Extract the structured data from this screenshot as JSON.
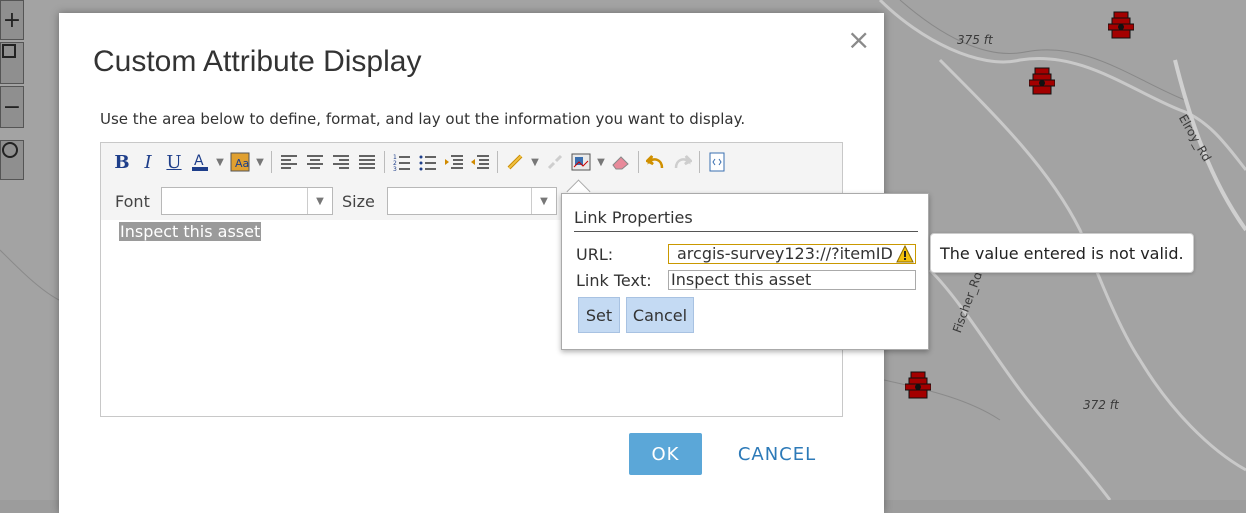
{
  "map": {
    "elevation_labels": [
      "375 ft",
      "372 ft"
    ],
    "road_labels": [
      "Elroy_Rd",
      "Fischer_Rd"
    ],
    "zoom_in": "+",
    "zoom_out": "−"
  },
  "dialog": {
    "title": "Custom Attribute Display",
    "close": "×",
    "instructions": "Use the area below to define, format, and lay out the information you want to display.",
    "toolbar": {
      "font_label": "Font",
      "font_value": "",
      "size_label": "Size",
      "size_value": ""
    },
    "editor_text": "Inspect this asset",
    "ok": "OK",
    "cancel": "CANCEL"
  },
  "link_popup": {
    "title": "Link Properties",
    "url_label": "URL:",
    "url_value": "arcgis-survey123://?itemID",
    "link_text_label": "Link Text:",
    "link_text_value": "Inspect this asset",
    "set": "Set",
    "cancel": "Cancel"
  },
  "tooltip": {
    "message": "The value entered is not valid."
  },
  "colors": {
    "ok_button": "#5ba7d8",
    "cancel_link": "#2d7ab8",
    "popup_button": "#c4daf3",
    "hydrant": "#a30000"
  }
}
